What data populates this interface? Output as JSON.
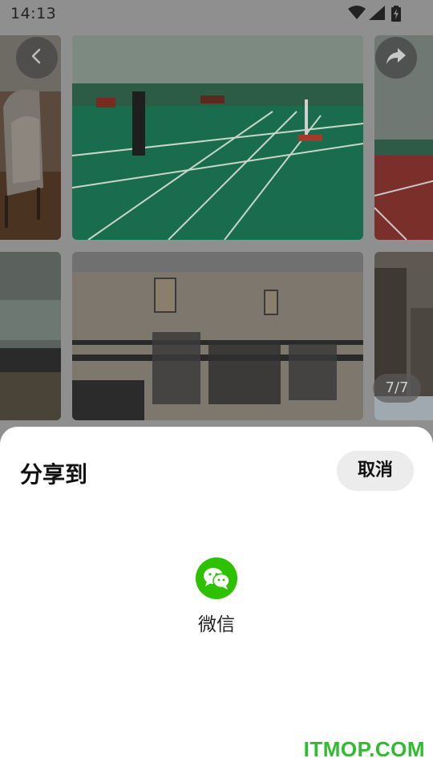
{
  "status_bar": {
    "time": "14:13",
    "icons": [
      "wifi-icon",
      "signal-icon",
      "battery-charging-icon"
    ]
  },
  "viewer": {
    "counter": "7/7",
    "icons": [
      "back-icon",
      "share-icon"
    ]
  },
  "share_sheet": {
    "title": "分享到",
    "cancel_label": "取消",
    "targets": [
      {
        "label": "微信",
        "icon": "wechat-icon",
        "color": "#2dc100"
      }
    ]
  },
  "watermark": "ITMOP.COM",
  "colors": {
    "dim_overlay": "#8f8f8f",
    "sheet_bg": "#ffffff",
    "wechat": "#2dc100",
    "watermark": "#2dbd2d"
  }
}
